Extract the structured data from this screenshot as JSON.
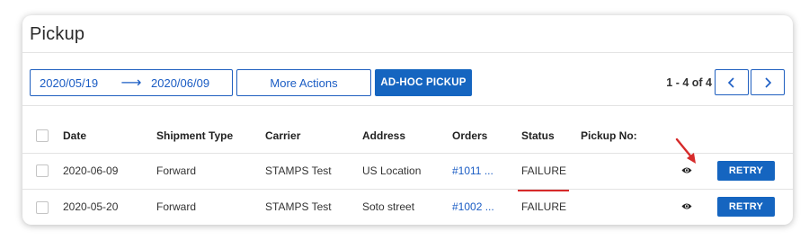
{
  "page": {
    "title": "Pickup"
  },
  "toolbar": {
    "date_start": "2020/05/19",
    "date_arrow": "⟶",
    "date_end": "2020/06/09",
    "more_actions_label": "More Actions",
    "adhoc_label": "AD-HOC PICKUP",
    "pagination_text": "1 - 4 of 4",
    "prev_icon": "chevron-left-icon",
    "next_icon": "chevron-right-icon"
  },
  "table": {
    "headers": {
      "date": "Date",
      "shipment_type": "Shipment Type",
      "carrier": "Carrier",
      "address": "Address",
      "orders": "Orders",
      "status": "Status",
      "pickup_no": "Pickup No:"
    },
    "rows": [
      {
        "date": "2020-06-09",
        "shipment_type": "Forward",
        "carrier": "STAMPS Test",
        "address": "US Location",
        "orders": "#1011 ...",
        "status": "FAILURE",
        "pickup_no": "",
        "action_label": "RETRY"
      },
      {
        "date": "2020-05-20",
        "shipment_type": "Forward",
        "carrier": "STAMPS Test",
        "address": "Soto street",
        "orders": "#1002 ...",
        "status": "FAILURE",
        "pickup_no": "",
        "action_label": "RETRY"
      }
    ]
  },
  "colors": {
    "primary": "#1565c0",
    "link": "#1a5cc4",
    "annotation": "#d62a2a"
  },
  "icons": {
    "view": "eye-icon",
    "annotation": "red-arrow-annotation"
  }
}
